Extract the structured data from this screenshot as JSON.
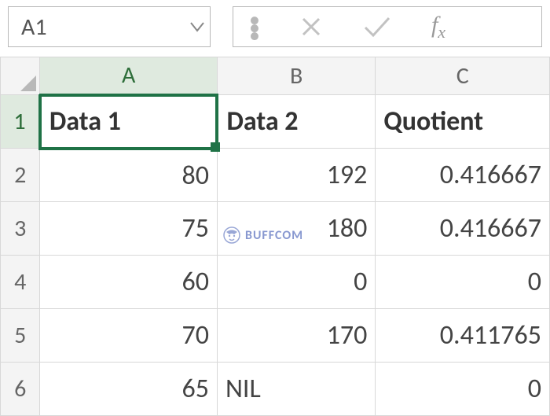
{
  "formula_bar": {
    "name_box": "A1",
    "fx_label": "fx"
  },
  "columns": [
    "A",
    "B",
    "C"
  ],
  "row_numbers": [
    "1",
    "2",
    "3",
    "4",
    "5",
    "6"
  ],
  "rows": [
    {
      "A": {
        "v": "Data 1",
        "t": "txt",
        "b": true
      },
      "B": {
        "v": "Data 2",
        "t": "txt",
        "b": true
      },
      "C": {
        "v": "Quotient",
        "t": "txt",
        "b": true
      }
    },
    {
      "A": {
        "v": "80",
        "t": "num"
      },
      "B": {
        "v": "192",
        "t": "num"
      },
      "C": {
        "v": "0.416667",
        "t": "num"
      }
    },
    {
      "A": {
        "v": "75",
        "t": "num"
      },
      "B": {
        "v": "180",
        "t": "num"
      },
      "C": {
        "v": "0.416667",
        "t": "num"
      }
    },
    {
      "A": {
        "v": "60",
        "t": "num"
      },
      "B": {
        "v": "0",
        "t": "num"
      },
      "C": {
        "v": "0",
        "t": "num"
      }
    },
    {
      "A": {
        "v": "70",
        "t": "num"
      },
      "B": {
        "v": "170",
        "t": "num"
      },
      "C": {
        "v": "0.411765",
        "t": "num"
      }
    },
    {
      "A": {
        "v": "65",
        "t": "num"
      },
      "B": {
        "v": "NIL",
        "t": "txt"
      },
      "C": {
        "v": "0",
        "t": "num"
      }
    }
  ],
  "active_cell": {
    "row": 0,
    "col": "A"
  },
  "watermark": "BUFFCOM",
  "chart_data": {
    "type": "table",
    "title": "",
    "columns": [
      "Data 1",
      "Data 2",
      "Quotient"
    ],
    "rows": [
      [
        80,
        192,
        0.416667
      ],
      [
        75,
        180,
        0.416667
      ],
      [
        60,
        0,
        0
      ],
      [
        70,
        170,
        0.411765
      ],
      [
        65,
        "NIL",
        0
      ]
    ]
  }
}
